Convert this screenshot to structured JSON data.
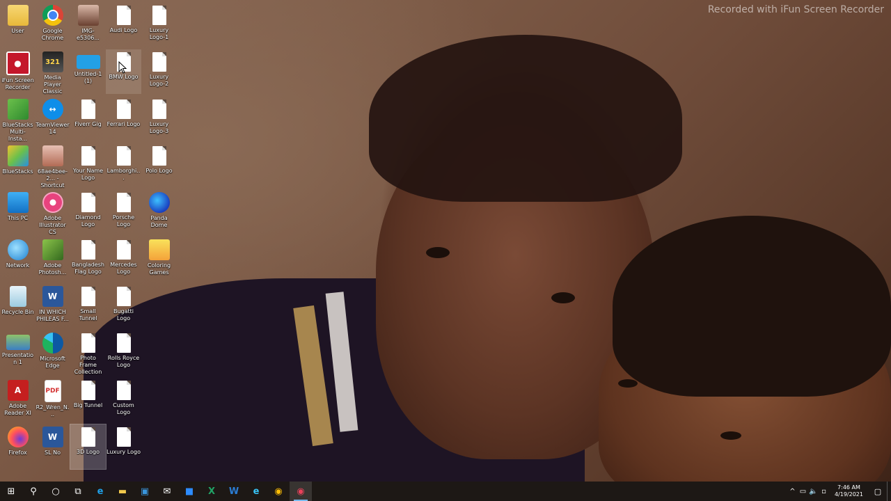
{
  "watermark": "Recorded with iFun Screen Recorder",
  "desktop_icons": [
    {
      "label": "User",
      "icon": "folder-icon",
      "style": "i-folder",
      "glyph": ""
    },
    {
      "label": "Google Chrome",
      "icon": "chrome-icon",
      "style": "i-chrome",
      "glyph": ""
    },
    {
      "label": "IMG-e5306...",
      "icon": "image-file-icon",
      "style": "i-photo",
      "glyph": ""
    },
    {
      "label": "Audi Logo",
      "icon": "blank-file-icon",
      "style": "file",
      "glyph": ""
    },
    {
      "label": "Luxury Logo-1",
      "icon": "blank-file-icon",
      "style": "file",
      "glyph": ""
    },
    {
      "label": "iFun Screen Recorder",
      "icon": "ifun-recorder-icon",
      "style": "i-ifun",
      "glyph": "●"
    },
    {
      "label": "Media Player Classic",
      "icon": "media-player-icon",
      "style": "i-mpc",
      "glyph": "321"
    },
    {
      "label": "Untitled-1 (1)",
      "icon": "image-file-icon",
      "style": "i-untitled",
      "glyph": ""
    },
    {
      "label": "BMW Logo",
      "icon": "blank-file-icon",
      "style": "file",
      "glyph": ""
    },
    {
      "label": "Luxury Logo-2",
      "icon": "blank-file-icon",
      "style": "file",
      "glyph": ""
    },
    {
      "label": "BlueStacks Multi-Insta...",
      "icon": "bluestacks-multi-icon",
      "style": "i-bluestack-multi",
      "glyph": ""
    },
    {
      "label": "TeamViewer 14",
      "icon": "teamviewer-icon",
      "style": "i-teamviewer",
      "glyph": "↔"
    },
    {
      "label": "Fiverr Gig",
      "icon": "blank-file-icon",
      "style": "file",
      "glyph": ""
    },
    {
      "label": "Ferrari Logo",
      "icon": "blank-file-icon",
      "style": "file",
      "glyph": ""
    },
    {
      "label": "Luxury Logo-3",
      "icon": "blank-file-icon",
      "style": "file",
      "glyph": ""
    },
    {
      "label": "BlueStacks",
      "icon": "bluestacks-icon",
      "style": "i-bluestacks",
      "glyph": ""
    },
    {
      "label": "68ae4bee-2... - Shortcut",
      "icon": "image-shortcut-icon",
      "style": "i-shortcut",
      "glyph": ""
    },
    {
      "label": "Your Name Logo",
      "icon": "blank-file-icon",
      "style": "file",
      "glyph": ""
    },
    {
      "label": "Lamborghi...",
      "icon": "blank-file-icon",
      "style": "file",
      "glyph": ""
    },
    {
      "label": "Polo Logo",
      "icon": "blank-file-icon",
      "style": "file",
      "glyph": ""
    },
    {
      "label": "This PC",
      "icon": "computer-icon",
      "style": "i-thispc",
      "glyph": ""
    },
    {
      "label": "Adobe Illustrator CS",
      "icon": "illustrator-icon",
      "style": "i-illustrator",
      "glyph": ""
    },
    {
      "label": "Diamond Logo",
      "icon": "blank-file-icon",
      "style": "file",
      "glyph": ""
    },
    {
      "label": "Porsche Logo",
      "icon": "blank-file-icon",
      "style": "file",
      "glyph": ""
    },
    {
      "label": "Panda Dome",
      "icon": "panda-dome-icon",
      "style": "i-panda",
      "glyph": ""
    },
    {
      "label": "Network",
      "icon": "network-icon",
      "style": "i-network",
      "glyph": ""
    },
    {
      "label": "Adobe Photosh...",
      "icon": "photoshop-icon",
      "style": "i-photoshop",
      "glyph": ""
    },
    {
      "label": "Bangladesh Flag Logo",
      "icon": "blank-file-icon",
      "style": "file",
      "glyph": ""
    },
    {
      "label": "Mercedes Logo",
      "icon": "blank-file-icon",
      "style": "file",
      "glyph": ""
    },
    {
      "label": "Coloring Games",
      "icon": "coloring-games-icon",
      "style": "i-coloring",
      "glyph": ""
    },
    {
      "label": "Recycle Bin",
      "icon": "recycle-bin-icon",
      "style": "i-recycle",
      "glyph": ""
    },
    {
      "label": "IN WHICH PHILEAS F...",
      "icon": "word-doc-icon",
      "style": "i-word",
      "glyph": "W"
    },
    {
      "label": "Small Tunnel",
      "icon": "blank-file-icon",
      "style": "file",
      "glyph": ""
    },
    {
      "label": "Bugatti Logo",
      "icon": "blank-file-icon",
      "style": "file",
      "glyph": ""
    },
    null,
    {
      "label": "Presentation 1",
      "icon": "presentation-icon",
      "style": "i-presentation",
      "glyph": ""
    },
    {
      "label": "Microsoft Edge",
      "icon": "edge-icon",
      "style": "i-edge",
      "glyph": ""
    },
    {
      "label": "Photo Frame Collection",
      "icon": "blank-file-icon",
      "style": "file",
      "glyph": ""
    },
    {
      "label": "Rolls Royce Logo",
      "icon": "blank-file-icon",
      "style": "file",
      "glyph": ""
    },
    null,
    {
      "label": "Adobe Reader XI",
      "icon": "adobe-reader-icon",
      "style": "i-reader",
      "glyph": "A"
    },
    {
      "label": "R2_Wren_N...",
      "icon": "pdf-file-icon",
      "style": "i-pdf",
      "glyph": "PDF"
    },
    {
      "label": "Big Tunnel",
      "icon": "blank-file-icon",
      "style": "file",
      "glyph": ""
    },
    {
      "label": "Custom Logo",
      "icon": "blank-file-icon",
      "style": "file",
      "glyph": ""
    },
    null,
    {
      "label": "Firefox",
      "icon": "firefox-icon",
      "style": "i-firefox",
      "glyph": ""
    },
    {
      "label": "SL No",
      "icon": "word-doc-icon",
      "style": "i-word",
      "glyph": "W"
    },
    {
      "label": "3D Logo",
      "icon": "blank-file-icon",
      "style": "file",
      "glyph": "",
      "state": "selected"
    },
    {
      "label": "Luxury Logo",
      "icon": "blank-file-icon",
      "style": "file",
      "glyph": ""
    },
    null
  ],
  "hovered_icon": "BMW Logo",
  "taskbar": {
    "pinned": [
      {
        "name": "start-button",
        "icon": "windows-logo-icon",
        "glyph": "⊞"
      },
      {
        "name": "search-button",
        "icon": "search-icon",
        "glyph": "⚲"
      },
      {
        "name": "cortana-button",
        "icon": "cortana-icon",
        "glyph": "○"
      },
      {
        "name": "task-view-button",
        "icon": "task-view-icon",
        "glyph": "⧉"
      },
      {
        "name": "taskbar-edge",
        "icon": "edge-icon",
        "glyph": "e",
        "color": "#1fa0e8"
      },
      {
        "name": "taskbar-file-explorer",
        "icon": "folder-icon",
        "glyph": "▬",
        "color": "#f2c94c"
      },
      {
        "name": "taskbar-store",
        "icon": "store-icon",
        "glyph": "▣",
        "color": "#3a96dd"
      },
      {
        "name": "taskbar-mail",
        "icon": "mail-icon",
        "glyph": "✉",
        "color": "#ffffff"
      },
      {
        "name": "taskbar-zoom",
        "icon": "video-camera-icon",
        "glyph": "■",
        "color": "#2d8cff"
      },
      {
        "name": "taskbar-excel",
        "icon": "excel-icon",
        "glyph": "X",
        "color": "#21a366"
      },
      {
        "name": "taskbar-word",
        "icon": "word-icon",
        "glyph": "W",
        "color": "#2b7cd3"
      },
      {
        "name": "taskbar-edge-2",
        "icon": "edge-icon",
        "glyph": "e",
        "color": "#38c3f5"
      },
      {
        "name": "taskbar-chrome",
        "icon": "chrome-icon",
        "glyph": "◉",
        "color": "#fbbc05"
      },
      {
        "name": "taskbar-ifun-recorder",
        "icon": "ifun-recorder-icon",
        "glyph": "◉",
        "color": "#e8415a",
        "state": "running"
      }
    ],
    "tray": [
      {
        "name": "show-hidden-icons",
        "icon": "chevron-up-icon",
        "glyph": "^"
      },
      {
        "name": "network-status",
        "icon": "network-status-icon",
        "glyph": "▭"
      },
      {
        "name": "volume",
        "icon": "speaker-icon",
        "glyph": "🔈"
      },
      {
        "name": "input-method",
        "icon": "keyboard-icon",
        "glyph": "▫"
      }
    ],
    "clock_time": "7:46 AM",
    "clock_date": "4/19/2021",
    "notification_glyph": "▢"
  }
}
